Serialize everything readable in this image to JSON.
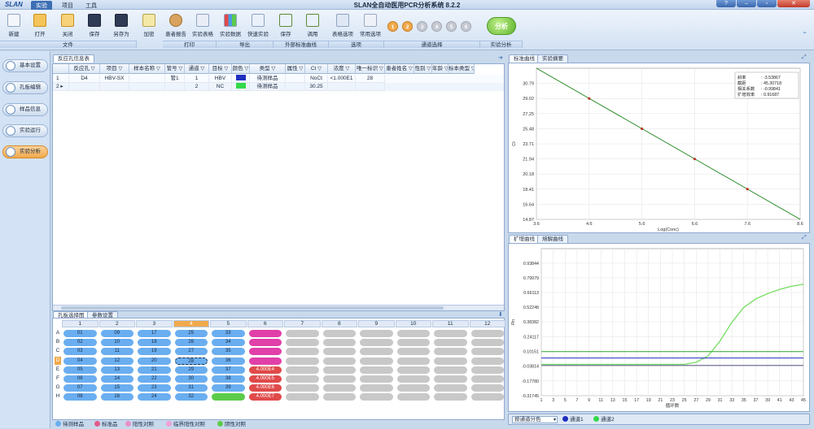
{
  "app": {
    "logo": "SLAN",
    "title": "SLAN全自动医用PCR分析系统 8.2.2",
    "menu_tabs": [
      "实验",
      "项目",
      "工具"
    ],
    "active_menu": "实验"
  },
  "ribbon": {
    "buttons": [
      "新建",
      "打开",
      "关闭",
      "保存",
      "另存为",
      "加密",
      "患者报告",
      "实验表格",
      "实验数据",
      "快速实验",
      "保存",
      "调用",
      "表格选项",
      "常用选项"
    ],
    "groups": [
      "文件",
      "打印",
      "导出",
      "外部标准曲线",
      "选项",
      "通道选择",
      "实验分析"
    ],
    "channel_circles": [
      "1",
      "2",
      "3",
      "4",
      "5",
      "6"
    ],
    "analyze_label": "分析"
  },
  "sidebar": {
    "items": [
      "基本设置",
      "孔板编辑",
      "样品信息",
      "实验运行",
      "实验分析"
    ],
    "active": "实验分析"
  },
  "reaction_table": {
    "tab": "反应孔信息表",
    "columns": [
      "",
      "反应孔",
      "项目",
      "样本名称",
      "管号",
      "通道",
      "目标",
      "颜色",
      "类型",
      "属性",
      "Ct",
      "浓度",
      "唯一标识",
      "患者姓名",
      "性别",
      "年龄",
      "标本类型"
    ],
    "rows": [
      {
        "num": "1",
        "well": "D4",
        "project": "HBV-SX",
        "sample": "",
        "tube": "管1",
        "channel": "1",
        "target": "HBV",
        "color": "#1f2fbf",
        "type": "待测样品",
        "attr": "",
        "ct": "NoCt",
        "conc": "<1.000E1",
        "uid": "28"
      },
      {
        "num": "2",
        "well": "",
        "project": "",
        "sample": "",
        "tube": "",
        "channel": "2",
        "target": "NC",
        "color": "#33d94a",
        "type": "待测样品",
        "attr": "",
        "ct": "30.25",
        "conc": "",
        "uid": ""
      }
    ]
  },
  "plate": {
    "tabs": [
      "孔板选择图",
      "参数设置"
    ],
    "columns": [
      "1",
      "2",
      "3",
      "4",
      "5",
      "6",
      "7",
      "8",
      "9",
      "10",
      "11",
      "12"
    ],
    "rows": [
      "A",
      "B",
      "C",
      "D",
      "E",
      "F",
      "G",
      "H"
    ],
    "selected_column": "4",
    "selected_row": "D",
    "blue_wells": [
      [
        "01",
        "09",
        "17",
        "25",
        "33"
      ],
      [
        "02",
        "10",
        "18",
        "26",
        "34"
      ],
      [
        "03",
        "11",
        "19",
        "27",
        "35"
      ],
      [
        "04",
        "12",
        "20",
        "28",
        "36"
      ],
      [
        "05",
        "13",
        "21",
        "29",
        "37"
      ],
      [
        "06",
        "14",
        "22",
        "30",
        "38"
      ],
      [
        "07",
        "15",
        "23",
        "31",
        "39"
      ],
      [
        "08",
        "16",
        "24",
        "32",
        ""
      ]
    ],
    "col6_labels": [
      "",
      "",
      "",
      "",
      "4.000E4",
      "4.000E5",
      "4.000E6",
      "4.000E7"
    ]
  },
  "legend": [
    "待测样品",
    "标准品",
    "阳性对照",
    "临界阳性对照",
    "阴性对照"
  ],
  "colors": {
    "sample": "#6aaef0",
    "standard": "#e040a8",
    "standard_red": "#e04a4a",
    "negative": "#5ccb4a",
    "empty": "#c8c8c8",
    "accent": "#f0a94c"
  },
  "std_curve": {
    "tabs": [
      "标准曲线",
      "实验摘要"
    ],
    "stats_labels": [
      "斜率",
      "截距",
      "相关系数",
      "扩增效率"
    ],
    "stats_values": [
      "-3.53867",
      "45.30718",
      "-0.99841",
      "0.91687"
    ],
    "xlabel": "Log(Conc)",
    "ylabel": "Ct",
    "yticks": [
      "30.79",
      "29.02",
      "27.25",
      "25.48",
      "23.71",
      "21.94",
      "20.18",
      "18.41",
      "16.64",
      "14.87"
    ],
    "xticks": [
      "3.6",
      "4.6",
      "5.6",
      "6.6",
      "7.6",
      "8.6"
    ]
  },
  "amp_curve": {
    "tabs": [
      "扩增曲线",
      "熔解曲线"
    ],
    "ylabel": "Rn",
    "xlabel": "循环数",
    "yticks": [
      "0.93844",
      "0.79979",
      "0.66113",
      "0.52248",
      "0.38382",
      "0.24117",
      "0.10151",
      "-0.03814",
      "-0.17780",
      "-0.31745"
    ],
    "xticks": [
      "1",
      "3",
      "5",
      "7",
      "9",
      "11",
      "13",
      "15",
      "17",
      "19",
      "21",
      "23",
      "25",
      "27",
      "29",
      "31",
      "33",
      "35",
      "37",
      "39",
      "41",
      "43",
      "45"
    ],
    "footer_select": "按通道分色",
    "footer_channels": [
      "通道1",
      "通道2"
    ]
  },
  "chart_data": [
    {
      "type": "scatter",
      "title": "",
      "xlabel": "Log(Conc)",
      "ylabel": "Ct",
      "xlim": [
        3.6,
        8.6
      ],
      "ylim": [
        14.87,
        32.56
      ],
      "points": [
        [
          4.6,
          29.02
        ],
        [
          5.6,
          25.48
        ],
        [
          6.6,
          21.94
        ],
        [
          7.6,
          18.41
        ]
      ],
      "fit_line": {
        "slope": -3.53867,
        "intercept": 45.30718
      }
    },
    {
      "type": "line",
      "title": "",
      "xlabel": "循环数",
      "ylabel": "Rn",
      "xlim": [
        1,
        45
      ],
      "ylim": [
        -0.31745,
        1.0771
      ],
      "series": [
        {
          "name": "通道2",
          "color": "#7ee06a",
          "x": [
            1,
            25,
            27,
            29,
            31,
            33,
            35,
            37,
            39,
            41,
            43,
            45
          ],
          "y": [
            -0.02,
            -0.02,
            0.0,
            0.06,
            0.2,
            0.38,
            0.52,
            0.6,
            0.65,
            0.69,
            0.72,
            0.74
          ]
        },
        {
          "name": "通道2",
          "color": "#2fa52f",
          "x": [
            1,
            45
          ],
          "y": [
            0.1,
            0.1
          ]
        },
        {
          "name": "通道1",
          "color": "#1f2fbf",
          "x": [
            1,
            45
          ],
          "y": [
            0.04,
            0.04
          ]
        },
        {
          "name": "通道1",
          "color": "#5a5a8a",
          "x": [
            1,
            45
          ],
          "y": [
            -0.03,
            -0.03
          ]
        }
      ]
    }
  ]
}
